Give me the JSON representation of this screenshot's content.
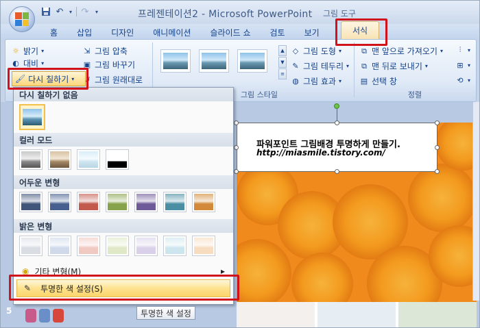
{
  "window": {
    "title": "프레젠테이션2 - Microsoft PowerPoint",
    "context_tab_group": "그림 도구"
  },
  "quick_access": {
    "save_icon": "save-icon",
    "undo_icon": "undo-icon",
    "redo_icon": "redo-icon"
  },
  "tabs": [
    "홈",
    "삽입",
    "디자인",
    "애니메이션",
    "슬라이드 쇼",
    "검토",
    "보기"
  ],
  "active_tab": "서식",
  "ribbon": {
    "adjust": {
      "brightness": "밝기",
      "contrast": "대비",
      "recolor": "다시 칠하기",
      "compress": "그림 압축",
      "change_picture": "그림 바꾸기",
      "reset_picture": "그림 원래대로"
    },
    "picture_styles": {
      "group_title": "그림 스타일",
      "shape": "그림 도형",
      "border": "그림 테두리",
      "effects": "그림 효과"
    },
    "arrange": {
      "group_title": "정렬",
      "bring_front": "맨 앞으로 가져오기",
      "send_back": "맨 뒤로 보내기",
      "selection_pane": "선택 창"
    }
  },
  "recolor_menu": {
    "no_recolor": "다시 칠하기 없음",
    "color_modes": "컬러 모드",
    "dark_variations": "어두운 변형",
    "light_variations": "밝은 변형",
    "more_variations": "기타 변형(M)",
    "set_transparent": "투명한 색 설정(S)",
    "dark_colors": [
      "#41557a",
      "#465f8f",
      "#c25a4e",
      "#86a24a",
      "#6e5a98",
      "#4a8ea4",
      "#d28a3a"
    ],
    "light_colors": [
      "#d9dde3",
      "#cfd9ea",
      "#f1c9c3",
      "#dfe9c7",
      "#d9d0ea",
      "#cde6ee",
      "#f7dcc0"
    ]
  },
  "tooltip": "투명한 색 설정",
  "slide": {
    "heading": "파워포인트 그림배경 투명하게 만들기.",
    "url": "http://miasmile.tistory.com/",
    "number": "5"
  }
}
